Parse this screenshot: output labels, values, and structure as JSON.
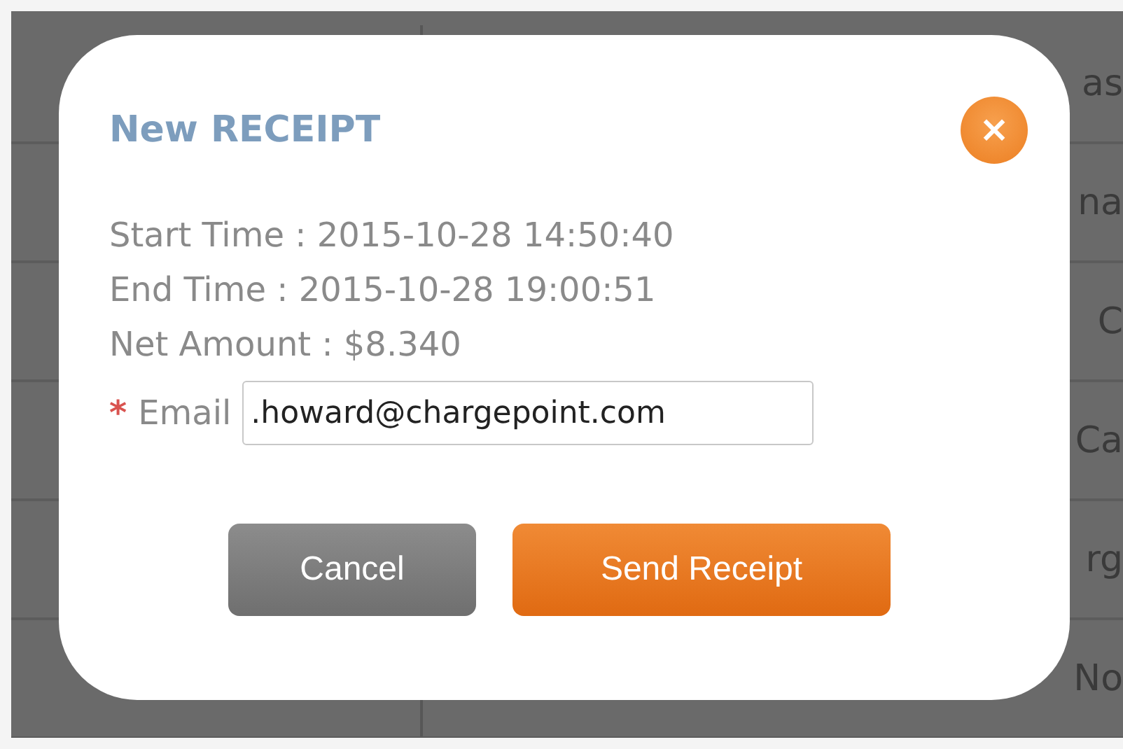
{
  "background_table": {
    "rows": [
      {
        "column_2": "as"
      },
      {
        "column_2": "na"
      },
      {
        "column_2": "C"
      },
      {
        "column_2": "Ca"
      },
      {
        "column_2": "rg"
      },
      {
        "column_2": "No"
      }
    ]
  },
  "dialog": {
    "title": "New RECEIPT",
    "close": "×",
    "details": [
      "Start Time : 2015-10-28 14:50:40",
      "End Time : 2015-10-28 19:00:51",
      "Net Amount : $8.340"
    ],
    "email": {
      "required_mark": "*",
      "label": "Email",
      "value": ".howard@chargepoint.com"
    },
    "buttons": [
      {
        "kind": "secondary",
        "label": "Cancel"
      },
      {
        "kind": "primary",
        "label": "Send Receipt"
      }
    ]
  }
}
